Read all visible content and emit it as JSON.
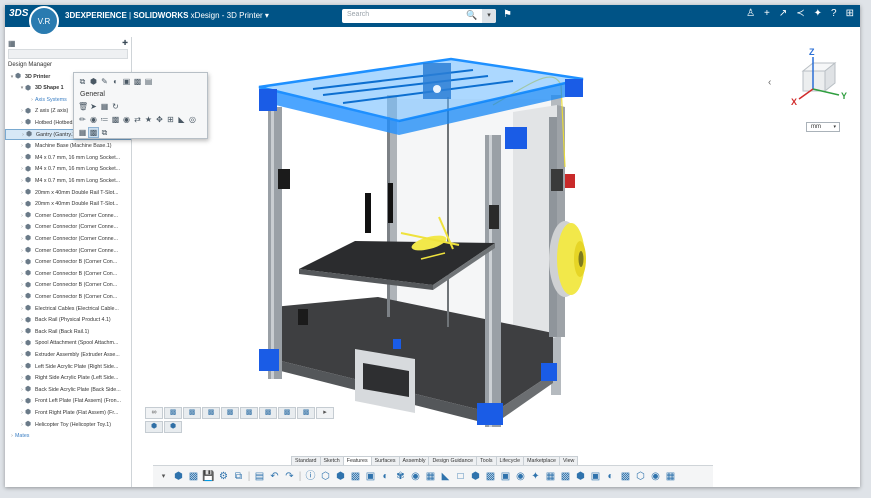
{
  "topbar": {
    "brand_logo": "3DS",
    "compass_label": "V.R",
    "brand": "3DEXPERIENCE",
    "separator": " | ",
    "product": "SOLIDWORKS",
    "app": " xDesign",
    "doc_title": " - 3D Printer",
    "title_caret": "▾",
    "search_placeholder": "Search",
    "search_icon": "search-icon",
    "search_caret": "▾",
    "tag_icon_glyph": "⌂",
    "right_icons": [
      {
        "name": "user-icon",
        "glyph": "♙"
      },
      {
        "name": "add-icon",
        "glyph": "+"
      },
      {
        "name": "share-icon",
        "glyph": "↗"
      },
      {
        "name": "network-icon",
        "glyph": "≺"
      },
      {
        "name": "apps-icon",
        "glyph": "✦"
      },
      {
        "name": "help-icon",
        "glyph": "?"
      },
      {
        "name": "compass-small-icon",
        "glyph": "⊞"
      }
    ]
  },
  "left_panel": {
    "design_manager": "Design Manager",
    "tree": [
      {
        "label": "3D Printer",
        "level": 0,
        "toggle": "▾",
        "kind": "root"
      },
      {
        "label": "3D Shape 1",
        "level": 1,
        "toggle": "▾",
        "kind": "shape"
      },
      {
        "label": "Axis Systems",
        "level": 2,
        "toggle": "›",
        "kind": "blue"
      },
      {
        "label": "Z axis (Z axis)",
        "level": 1,
        "toggle": "›",
        "kind": "part"
      },
      {
        "label": "Hotbed (Hotbed.1)",
        "level": 1,
        "toggle": "›",
        "kind": "part"
      },
      {
        "label": "Gantry (Gantry.1)",
        "level": 1,
        "toggle": "›",
        "kind": "sel"
      },
      {
        "label": "Machine Base (Machine Base.1)",
        "level": 1,
        "toggle": "›",
        "kind": "part"
      },
      {
        "label": "M4 x 0.7 mm, 16 mm Long Socket...",
        "level": 1,
        "toggle": "›",
        "kind": "part"
      },
      {
        "label": "M4 x 0.7 mm, 16 mm Long Socket...",
        "level": 1,
        "toggle": "›",
        "kind": "part"
      },
      {
        "label": "M4 x 0.7 mm, 16 mm Long Socket...",
        "level": 1,
        "toggle": "›",
        "kind": "part"
      },
      {
        "label": "20mm x 40mm Double Rail T-Slot...",
        "level": 1,
        "toggle": "›",
        "kind": "part"
      },
      {
        "label": "20mm x 40mm Double Rail T-Slot...",
        "level": 1,
        "toggle": "›",
        "kind": "part"
      },
      {
        "label": "Corner Connector (Corner Conne...",
        "level": 1,
        "toggle": "›",
        "kind": "part"
      },
      {
        "label": "Corner Connector (Corner Conne...",
        "level": 1,
        "toggle": "›",
        "kind": "part"
      },
      {
        "label": "Corner Connector (Corner Conne...",
        "level": 1,
        "toggle": "›",
        "kind": "part"
      },
      {
        "label": "Corner Connector (Corner Conne...",
        "level": 1,
        "toggle": "›",
        "kind": "part"
      },
      {
        "label": "Corner Connector B (Corner Con...",
        "level": 1,
        "toggle": "›",
        "kind": "part"
      },
      {
        "label": "Corner Connector B (Corner Con...",
        "level": 1,
        "toggle": "›",
        "kind": "part"
      },
      {
        "label": "Corner Connector B (Corner Con...",
        "level": 1,
        "toggle": "›",
        "kind": "part"
      },
      {
        "label": "Corner Connector B (Corner Con...",
        "level": 1,
        "toggle": "›",
        "kind": "part"
      },
      {
        "label": "Electrical Cables (Electrical Cable...",
        "level": 1,
        "toggle": "›",
        "kind": "part"
      },
      {
        "label": "Back Rail (Physical Product 4.1)",
        "level": 1,
        "toggle": "›",
        "kind": "part"
      },
      {
        "label": "Back Rail (Back Rail.1)",
        "level": 1,
        "toggle": "›",
        "kind": "part"
      },
      {
        "label": "Spool Attachment (Spool Attachm...",
        "level": 1,
        "toggle": "›",
        "kind": "part"
      },
      {
        "label": "Extruder Assembly (Extruder Asse...",
        "level": 1,
        "toggle": "›",
        "kind": "part"
      },
      {
        "label": "Left Side Acrylic Plate (Right Side...",
        "level": 1,
        "toggle": "›",
        "kind": "part"
      },
      {
        "label": "Right Side Acrylic Plate (Left Side...",
        "level": 1,
        "toggle": "›",
        "kind": "part"
      },
      {
        "label": "Back Side Acrylic Plate (Back Side...",
        "level": 1,
        "toggle": "›",
        "kind": "part"
      },
      {
        "label": "Front Left Plate (Flat Assem) (Fron...",
        "level": 1,
        "toggle": "›",
        "kind": "part"
      },
      {
        "label": "Front Right Plate (Flat Assem) (Fr...",
        "level": 1,
        "toggle": "›",
        "kind": "part"
      },
      {
        "label": "Helicopter Toy (Helicopter Toy.1)",
        "level": 1,
        "toggle": "›",
        "kind": "part"
      },
      {
        "label": "Mates",
        "level": 0,
        "toggle": "›",
        "kind": "blue"
      }
    ]
  },
  "context_menu": {
    "section_label": "General"
  },
  "viewport": {
    "collapse_arrow": "‹",
    "axis_z": "Z",
    "axis_x": "X",
    "axis_y": "Y",
    "units": "mm",
    "units_caret": "▾"
  },
  "bottom": {
    "tabs": [
      "Standard",
      "Sketch",
      "Features",
      "Surfaces",
      "Assembly",
      "Design Guidance",
      "Tools",
      "Lifecycle",
      "Marketplace",
      "View"
    ],
    "active_tab": "Features",
    "expand_caret": "▾"
  },
  "colors": {
    "topbar": "#005386",
    "highlight": "#1e90ff",
    "frame_blue": "#1a5ce6",
    "filament": "#f2e84a",
    "aluminum": "#9aa0a6"
  }
}
